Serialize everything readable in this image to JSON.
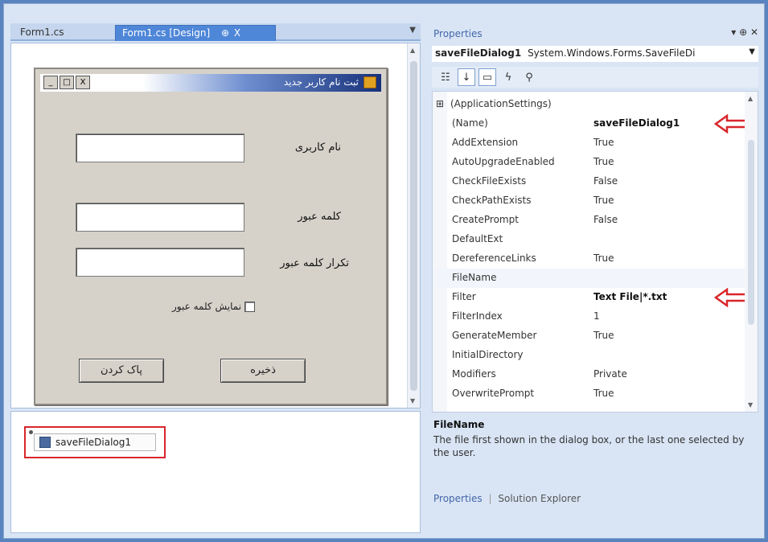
{
  "designer": {
    "tabs": [
      {
        "label": "Form1.cs"
      },
      {
        "label": "Form1.cs [Design]",
        "pin": "⊕",
        "close": "X"
      }
    ],
    "form": {
      "title": "ثبت نام کاربر جدید",
      "control_buttons": [
        "_",
        "□",
        "X"
      ],
      "labels": {
        "username": "نام کاربری",
        "password": "کلمه عبور",
        "confirm_password": "تکرار کلمه عبور",
        "show_password": "نمایش کلمه عبور"
      },
      "buttons": {
        "save": "ذخیره",
        "clear": "پاک کردن"
      }
    },
    "component_tray": {
      "component_label": "saveFileDialog1"
    }
  },
  "properties": {
    "title": "Properties",
    "title_controls": "▾ ⊕ ✕",
    "object_name": "saveFileDialog1",
    "object_type": "System.Windows.Forms.SaveFileDi",
    "rows": [
      {
        "name": "(ApplicationSettings)",
        "value": "",
        "category": true
      },
      {
        "name": "(Name)",
        "value": "saveFileDialog1",
        "bold": true,
        "arrow": true
      },
      {
        "name": "AddExtension",
        "value": "True"
      },
      {
        "name": "AutoUpgradeEnabled",
        "value": "True"
      },
      {
        "name": "CheckFileExists",
        "value": "False"
      },
      {
        "name": "CheckPathExists",
        "value": "True"
      },
      {
        "name": "CreatePrompt",
        "value": "False"
      },
      {
        "name": "DefaultExt",
        "value": ""
      },
      {
        "name": "DereferenceLinks",
        "value": "True"
      },
      {
        "name": "FileName",
        "value": "",
        "selected": true
      },
      {
        "name": "Filter",
        "value": "Text File|*.txt",
        "bold": true,
        "arrow": true
      },
      {
        "name": "FilterIndex",
        "value": "1"
      },
      {
        "name": "GenerateMember",
        "value": "True"
      },
      {
        "name": "InitialDirectory",
        "value": ""
      },
      {
        "name": "Modifiers",
        "value": "Private"
      },
      {
        "name": "OverwritePrompt",
        "value": "True"
      }
    ],
    "description": {
      "title": "FileName",
      "text": "The file first shown in the dialog box, or the last one selected by the user."
    },
    "bottom_tabs": [
      "Properties",
      "Solution Explorer"
    ],
    "arrow_color": "#d9262b"
  }
}
